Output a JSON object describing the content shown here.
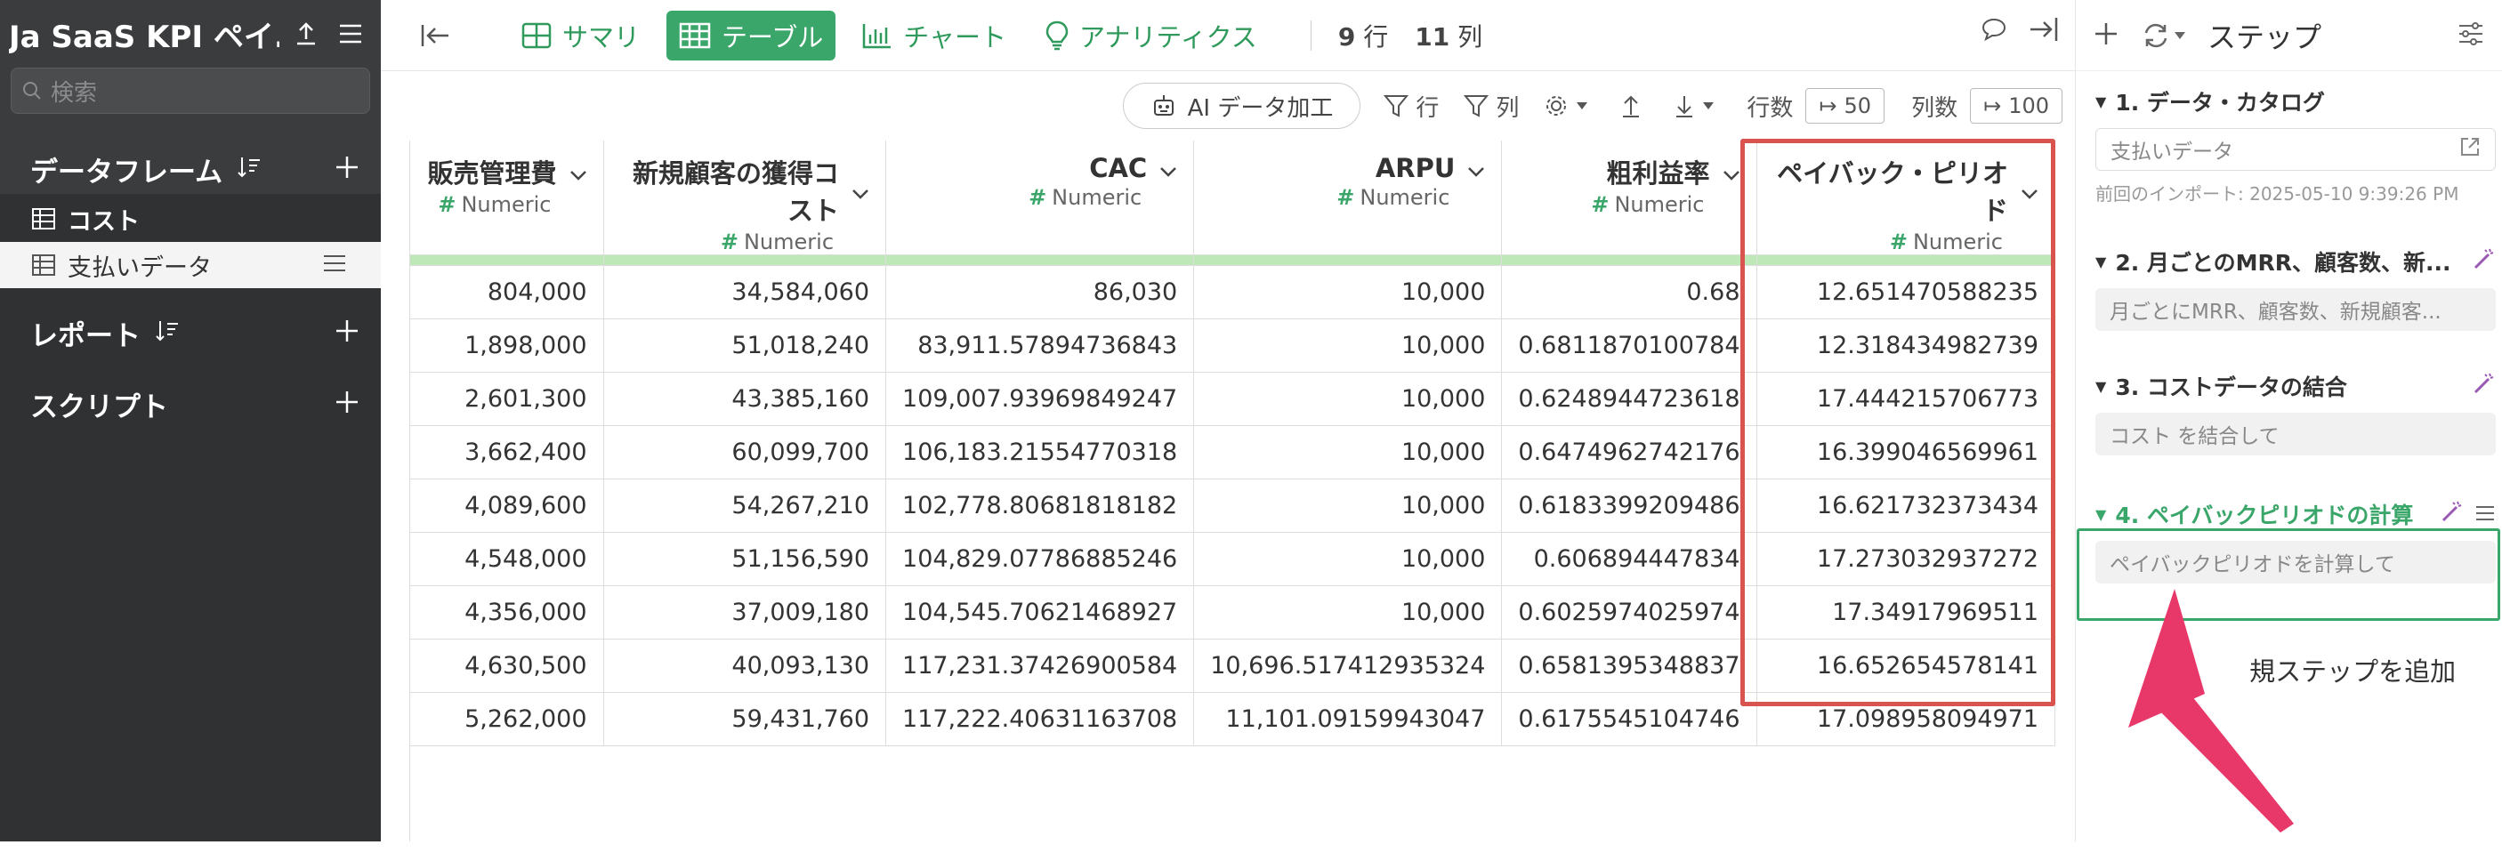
{
  "app": {
    "title": "Ja SaaS KPI ペイ..."
  },
  "sidebar": {
    "search_placeholder": "検索",
    "dataframes_label": "データフレーム",
    "items": [
      {
        "label": "コスト"
      },
      {
        "label": "支払いデータ"
      }
    ],
    "reports_label": "レポート",
    "scripts_label": "スクリプト"
  },
  "toolbar": {
    "summary": "サマリ",
    "table": "テーブル",
    "chart": "チャート",
    "analytics": "アナリティクス",
    "rows_count": "9",
    "rows_unit": "行",
    "cols_count": "11",
    "cols_unit": "列"
  },
  "subbar": {
    "ai_label": "AI データ加工",
    "row_filter": "行",
    "col_filter": "列",
    "row_count_label": "行数",
    "row_count_value": "50",
    "col_count_label": "列数",
    "col_count_value": "100"
  },
  "table": {
    "type_label": "Numeric",
    "columns": [
      "販売管理費",
      "新規顧客の獲得コスト",
      "CAC",
      "ARPU",
      "粗利益率",
      "ペイバック・ピリオド"
    ],
    "rows": [
      [
        "804,000",
        "34,584,060",
        "86,030",
        "10,000",
        "0.68",
        "12.651470588235"
      ],
      [
        "1,898,000",
        "51,018,240",
        "83,911.57894736843",
        "10,000",
        "0.6811870100784",
        "12.318434982739"
      ],
      [
        "2,601,300",
        "43,385,160",
        "109,007.93969849247",
        "10,000",
        "0.6248944723618",
        "17.444215706773"
      ],
      [
        "3,662,400",
        "60,099,700",
        "106,183.21554770318",
        "10,000",
        "0.6474962742176",
        "16.399046569961"
      ],
      [
        "4,089,600",
        "54,267,210",
        "102,778.80681818182",
        "10,000",
        "0.6183399209486",
        "16.621732373434"
      ],
      [
        "4,548,000",
        "51,156,590",
        "104,829.07786885246",
        "10,000",
        "0.606894447834",
        "17.273032937272"
      ],
      [
        "4,356,000",
        "37,009,180",
        "104,545.70621468927",
        "10,000",
        "0.6025974025974",
        "17.34917969511"
      ],
      [
        "4,630,500",
        "40,093,130",
        "117,231.37426900584",
        "10,696.517412935324",
        "0.6581395348837",
        "16.652654578141"
      ],
      [
        "5,262,000",
        "59,431,760",
        "117,222.40631163708",
        "11,101.09159943047",
        "0.6175545104746",
        "17.098958094971"
      ]
    ]
  },
  "right_panel": {
    "title": "ステップ",
    "steps": [
      {
        "title": "1. データ・カタログ",
        "value": "支払いデータ",
        "meta": "前回のインポート: 2025-05-10 9:39:26 PM"
      },
      {
        "title": "2. 月ごとのMRR、顧客数、新...",
        "value": "月ごとにMRR、顧客数、新規顧客..."
      },
      {
        "title": "3. コストデータの結合",
        "value": "コスト を結合して"
      },
      {
        "title": "4. ペイバックピリオドの計算",
        "value": "ペイバックピリオドを計算して"
      }
    ],
    "add_step": "規ステップを追加"
  },
  "colors": {
    "accent": "#3aa66a",
    "highlight": "#d9534f",
    "arrow": "#e8386a"
  }
}
